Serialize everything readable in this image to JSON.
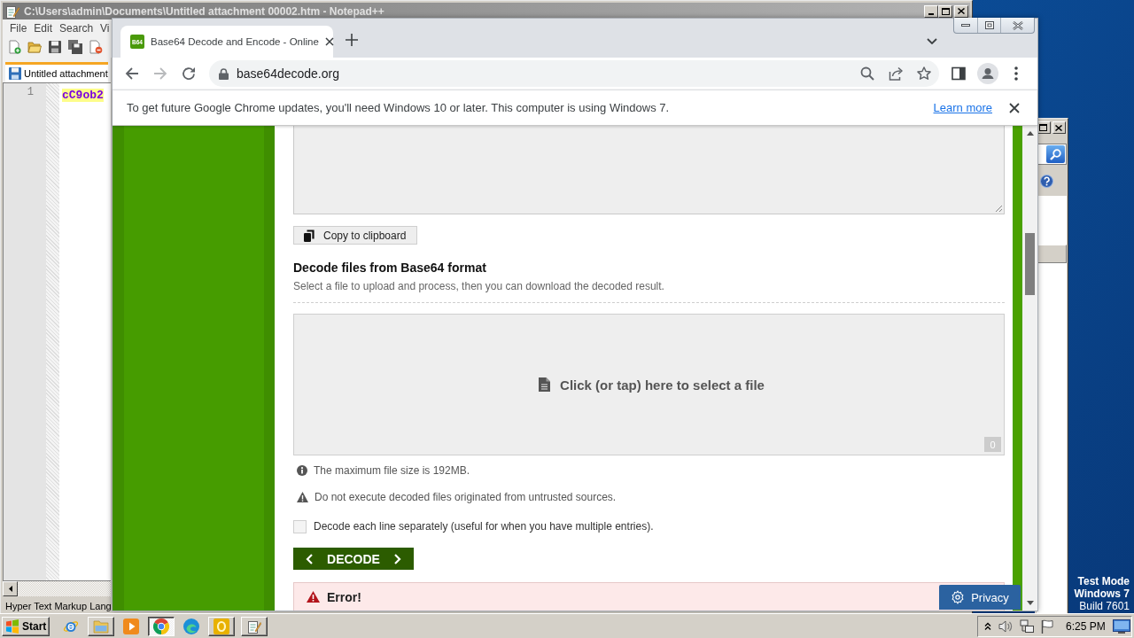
{
  "notepad": {
    "title": "C:\\Users\\admin\\Documents\\Untitled attachment 00002.htm - Notepad++",
    "menu": [
      "File",
      "Edit",
      "Search",
      "Vi"
    ],
    "tab": "Untitled attachment",
    "lines": [
      {
        "number": "1",
        "text": "cC9ob2"
      }
    ],
    "status": "Hyper Text Markup Lang"
  },
  "browser": {
    "tabs": [
      {
        "favicon": "B64",
        "title": "Base64 Decode and Encode - Online",
        "selected": true
      }
    ],
    "nav_buttons": [
      {
        "kind": "back",
        "disabled": false
      },
      {
        "kind": "forward",
        "disabled": true
      },
      {
        "kind": "reload",
        "disabled": false
      }
    ],
    "url": "base64decode.org",
    "infobar": {
      "text": "To get future Google Chrome updates, you'll need Windows 10 or later. This computer is using Windows 7.",
      "link": "Learn more"
    }
  },
  "page": {
    "copy_button": "Copy to clipboard",
    "heading": "Decode files from Base64 format",
    "subtitle": "Select a file to upload and process, then you can download the decoded result.",
    "dropzone": {
      "label": "Click (or tap) here to select a file",
      "count": "0"
    },
    "notes": [
      {
        "kind": "info",
        "text": "The maximum file size is 192MB."
      },
      {
        "kind": "warning",
        "text": "Do not execute decoded files originated from untrusted sources."
      }
    ],
    "options": [
      {
        "label": "Decode each line separately (useful for when you have multiple entries).",
        "checked": false
      }
    ],
    "decode_button": "DECODE",
    "error": {
      "title": "Error!"
    },
    "privacy_button": "Privacy"
  },
  "desktop": {
    "test_mode": [
      "Test Mode",
      "Windows 7",
      "Build 7601"
    ]
  },
  "taskbar": {
    "start": "Start",
    "apps": [
      {
        "kind": "ie",
        "running": false,
        "selected": false
      },
      {
        "kind": "explorer",
        "running": true,
        "selected": false
      },
      {
        "kind": "media",
        "running": false,
        "selected": false
      },
      {
        "kind": "chrome",
        "running": true,
        "selected": true
      },
      {
        "kind": "edge",
        "running": false,
        "selected": false
      },
      {
        "kind": "tile",
        "running": true,
        "selected": false
      },
      {
        "kind": "notepad",
        "running": true,
        "selected": false
      }
    ],
    "clock": "6:25 PM"
  }
}
